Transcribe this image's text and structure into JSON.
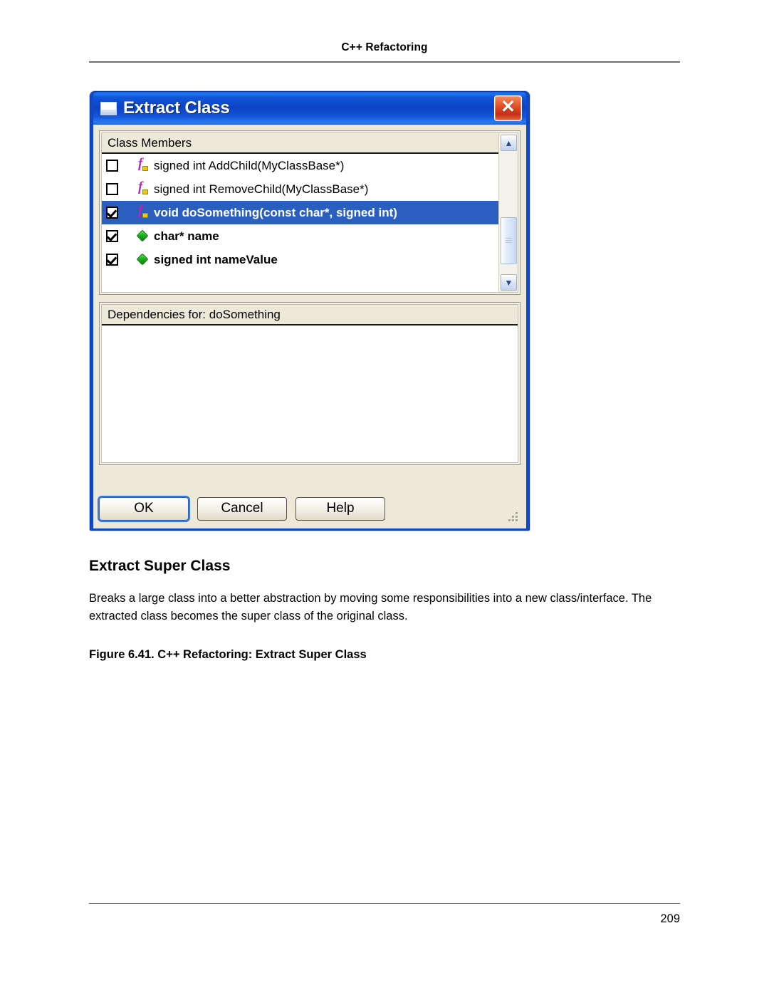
{
  "page": {
    "running_header": "C++ Refactoring",
    "number": "209"
  },
  "dialog": {
    "title": "Extract Class",
    "window_icon": "window-icon",
    "close_icon": "✕",
    "members": {
      "column_header": "Class Members",
      "rows": [
        {
          "checked": false,
          "icon": "method-icon",
          "label": "signed int AddChild(MyClassBase*)",
          "selected": false
        },
        {
          "checked": false,
          "icon": "method-icon",
          "label": "signed int RemoveChild(MyClassBase*)",
          "selected": false
        },
        {
          "checked": true,
          "icon": "method-icon",
          "label": "void doSomething(const char*, signed int)",
          "selected": true
        },
        {
          "checked": true,
          "icon": "field-icon",
          "label": "char* name",
          "selected": false
        },
        {
          "checked": true,
          "icon": "field-icon",
          "label": "signed int nameValue",
          "selected": false
        }
      ],
      "scrollbar": {
        "up_icon": "▲",
        "down_icon": "▼"
      }
    },
    "dependencies": {
      "column_header": "Dependencies for: doSomething",
      "rows": []
    },
    "buttons": {
      "ok": "OK",
      "cancel": "Cancel",
      "help": "Help"
    }
  },
  "article": {
    "section_title": "Extract Super Class",
    "body": "Breaks a large class into a better abstraction by moving some responsibilities into a new class/interface. The extracted class becomes the super class of the original class.",
    "figure_caption": "Figure 6.41.  C++ Refactoring: Extract Super Class"
  },
  "colors": {
    "titlebar_blue": "#1049c8",
    "close_red": "#c62d16",
    "selection_blue": "#2a5fbf",
    "dialog_face": "#ece9d8",
    "method_icon": "#b42ab4",
    "field_icon": "#19b519"
  }
}
